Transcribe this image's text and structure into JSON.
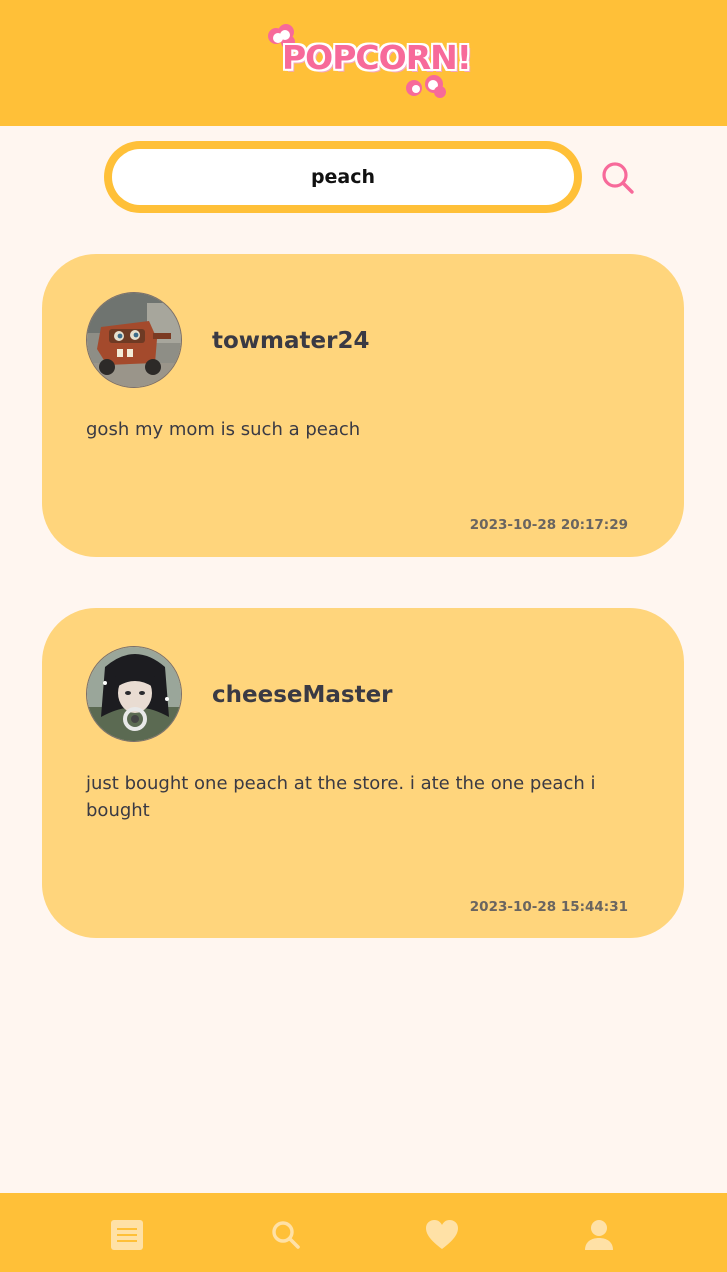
{
  "app": {
    "logo_text": "POPCORN!"
  },
  "colors": {
    "header_bg": "#ffc038",
    "page_bg": "#fff6f0",
    "card_bg": "#ffd57c",
    "accent_pink": "#f76a9a",
    "nav_icon": "#ffe1a6"
  },
  "search": {
    "value": "peach",
    "button_icon": "search-icon"
  },
  "posts": [
    {
      "username": "towmater24",
      "avatar": "avatar-tow-truck",
      "text": "gosh my mom is such a peach",
      "timestamp": "2023-10-28 20:17:29"
    },
    {
      "username": "cheeseMaster",
      "avatar": "avatar-anime-character",
      "text": "just bought one peach at the store. i ate the one peach i bought",
      "timestamp": "2023-10-28 15:44:31"
    }
  ],
  "nav": {
    "items": [
      {
        "icon": "feed-icon"
      },
      {
        "icon": "search-icon"
      },
      {
        "icon": "heart-icon"
      },
      {
        "icon": "user-icon"
      }
    ]
  }
}
